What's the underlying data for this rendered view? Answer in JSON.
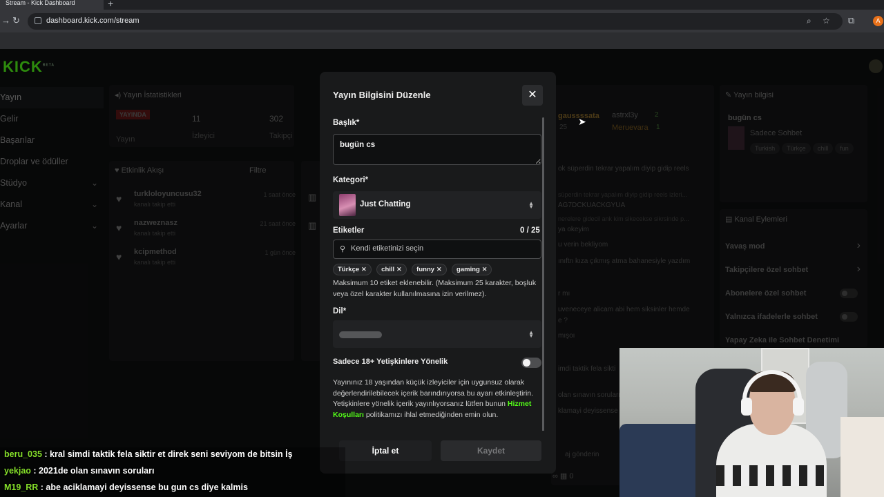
{
  "browser": {
    "tab_title": "Stream - Kick Dashboard",
    "url": "dashboard.kick.com/stream",
    "profile_initial": "A"
  },
  "site": {
    "logo": "KICK",
    "logo_sup": "BETA"
  },
  "sidebar": {
    "items": [
      {
        "label": "Yayın"
      },
      {
        "label": "Gelir"
      },
      {
        "label": "Başarılar"
      },
      {
        "label": "Droplar ve ödüller"
      },
      {
        "label": "Stüdyo"
      },
      {
        "label": "Kanal"
      },
      {
        "label": "Ayarlar"
      }
    ]
  },
  "stats_panel": {
    "title": "Yayın İstatistikleri",
    "live_badge": "YAYINDA",
    "live_label": "Yayın",
    "viewers_value": "11",
    "viewers_label": "İzleyici",
    "followers_value": "302",
    "followers_label": "Takipçi"
  },
  "activity_panel": {
    "title": "Etkinlik Akışı",
    "filter_label": "Filtre",
    "items": [
      {
        "name": "turkloloyuncusu32",
        "action": "kanalı takip etti",
        "time": "1 saat önce"
      },
      {
        "name": "nazweznasz",
        "action": "kanalı takip etti",
        "time": "21 saat önce"
      },
      {
        "name": "kcipmethod",
        "action": "kanalı takip etti",
        "time": "1 gün önce"
      }
    ]
  },
  "chat_bg": {
    "users": [
      "gaussssata",
      "astrxl3y",
      "Meruevara"
    ],
    "counts": [
      "2",
      "1",
      "25"
    ],
    "lines": [
      "ok süperdin tekrar yapalım diyip gidip reels",
      "süperdin tekrar yapalım diyip gidip reels izleri...",
      "AG7DCKUACKGYUA",
      "nerelere gidecil ank kim sikecekse sikrsinde p...",
      "ya okeyim",
      "u verin bekliyom",
      "ınıftn kıza çıkmış atma bahanesiyle yazdım",
      "r mı",
      "uveneceye alicam abi hem siksinler hemde",
      "e ?",
      "mışoı",
      "imdi taktik fela sikti",
      "olan sınavın soruları",
      "klamayi deyissense",
      "aj gönderin"
    ]
  },
  "right_panel": {
    "info_title": "Yayın bilgisi",
    "stream_title": "bugün cs",
    "category": "Sadece Sohbet",
    "tags": [
      "Turkish",
      "Türkçe",
      "chill",
      "fun"
    ],
    "actions_title": "Kanal Eylemleri",
    "actions": [
      {
        "label": "Yavaş mod"
      },
      {
        "label": "Takipçilere özel sohbet"
      },
      {
        "label": "Abonelere özel sohbet"
      },
      {
        "label": "Yalnızca ifadelerle sohbet"
      },
      {
        "label": "Yapay Zeka ile Sohbet Denetimi"
      }
    ]
  },
  "modal": {
    "title": "Yayın Bilgisini Düzenle",
    "title_label": "Başlık*",
    "title_value": "bugün cs",
    "category_label": "Kategori*",
    "category_value": "Just Chatting",
    "tags_label": "Etiketler",
    "tags_counter": "0 / 25",
    "tags_placeholder": "Kendi etiketinizi seçin",
    "tags": [
      "Türkçe",
      "chill",
      "funny",
      "gaming"
    ],
    "tags_help": "Maksimum 10 etiket eklenebilir. (Maksimum 25 karakter, boşluk veya özel karakter kullanılmasına izin verilmez).",
    "language_label": "Dil*",
    "adult_label": "Sadece 18+ Yetişkinlere Yönelik",
    "adult_enabled": false,
    "adult_desc_before": "Yayınınız 18 yaşından küçük izleyiciler için uygunsuz olarak değerlendirilebilecek içerik barındırıyorsa bu ayarı etkinleştirin. Yetişkinlere yönelik içerik yayınlıyorsanız lütfen bunun ",
    "adult_desc_link": "Hizmet Koşulları",
    "adult_desc_after": " politikamızı ihlal etmediğinden emin olun.",
    "cancel_label": "İptal et",
    "save_label": "Kaydet"
  },
  "overlay_chat": [
    {
      "user": "beru_035",
      "message": " : kral simdi taktik fela siktir et direk seni seviyom de bitsin İş"
    },
    {
      "user": "yekjao",
      "message": " : 2021de olan sınavın soruları"
    },
    {
      "user": "M19_RR",
      "message": " : abe aciklamayi deyissense bu gun cs diye kalmis"
    }
  ],
  "bottom_counts": {
    "viewers": "0"
  }
}
